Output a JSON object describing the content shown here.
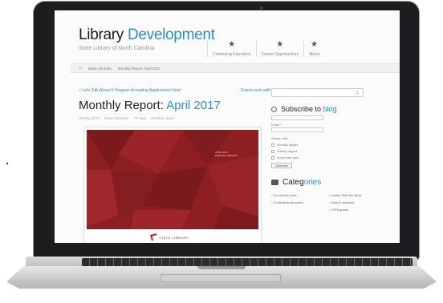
{
  "site": {
    "title_main": "Library",
    "title_accent": "Development",
    "tagline": "State Library of North Carolina"
  },
  "topnav": [
    {
      "label": "Continuing Education",
      "icon": "star-icon"
    },
    {
      "label": "Career Opportunities",
      "icon": "star-icon"
    },
    {
      "label": "About",
      "icon": "star-icon"
    }
  ],
  "breadcrumb": [
    "State Librarian",
    "Monthly Report: April 2017"
  ],
  "post_nav": {
    "prev": "« Let's Talk About It Program Accepting Applications Now!",
    "next": "Grants work with us »"
  },
  "post": {
    "title_main": "Monthly Report:",
    "title_accent": "April 2017",
    "meta": [
      "22 May 2017",
      "Dawn Strassler",
      "70 Tags",
      "Monthly report"
    ],
    "image_caption": "APRIL 2017 MONTHLY REPORT",
    "image_logo": "STATE LIBRARY"
  },
  "sidebar": {
    "subscribe_main": "Subscribe to",
    "subscribe_accent": "blog",
    "email_label": "Email *",
    "select_label": "Select a list:",
    "options": [
      "Monthly digest",
      "Weekly digest",
      "Every new post"
    ],
    "subscribe_button": "Subscribe",
    "categories_main": "Categ",
    "categories_accent": "ories",
    "categories": [
      "Around the state",
      "Career Plan the Buck",
      "Continuing education",
      "Data & research",
      "",
      "LSTA grants"
    ]
  },
  "colors": {
    "accent": "#2d8fc4",
    "image_red": "#8d1f22",
    "bezel": "#1d1d1f"
  }
}
